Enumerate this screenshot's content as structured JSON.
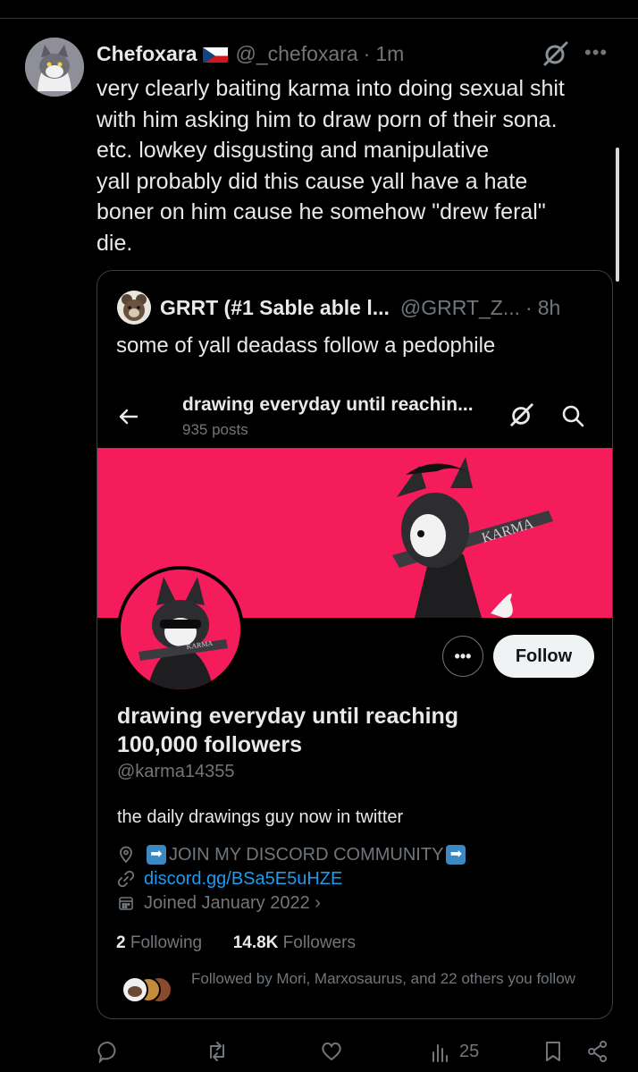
{
  "tweet": {
    "name": "Chefoxara",
    "handle": "@_chefoxara",
    "separator": "·",
    "time": "1m",
    "text": "very clearly baiting karma into doing sexual shit\nwith him asking him to draw porn of their sona.\netc.  lowkey disgusting and manipulative\nyall probably did this cause yall have a hate\nboner on him cause he somehow \"drew feral\"\ndie."
  },
  "quote": {
    "name": "GRRT (#1 Sable able l...",
    "handle": "@GRRT_Z...",
    "separator": "·",
    "time": "8h",
    "text": "some of yall deadass follow a pedophile"
  },
  "profile": {
    "header_title": "drawing everyday until reachin...",
    "posts_count": "935 posts",
    "banner_text": "KARMA",
    "pfp_text": "KARMA",
    "more_label": "•••",
    "follow_label": "Follow",
    "display_name": "drawing everyday until reaching 100,000 followers",
    "handle": "@karma14355",
    "bio": "the daily drawings guy now in twitter",
    "location": "JOIN MY DISCORD COMMUNITY",
    "location_arrow": "➡",
    "link": "discord.gg/BSa5E5uHZE",
    "joined": "Joined January 2022 ›",
    "following_count": "2",
    "following_label": "Following",
    "followers_count": "14.8K",
    "followers_label": "Followers",
    "followed_by": "Followed by Mori, Marxosaurus, and 22 others you follow"
  },
  "actions": {
    "views_count": "25"
  },
  "colors": {
    "background": "#000000",
    "banner": "#f41c5a",
    "link": "#1d9bf0",
    "muted": "#71767b"
  }
}
